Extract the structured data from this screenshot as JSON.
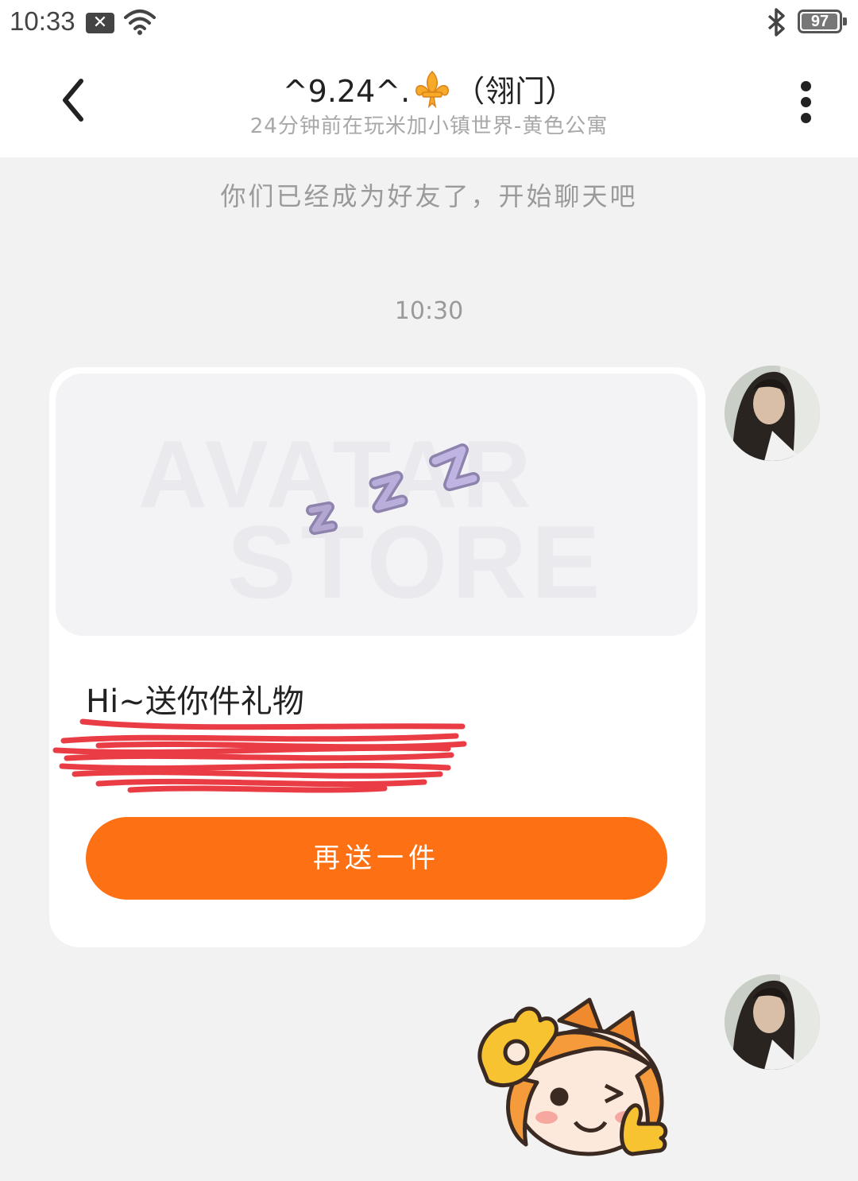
{
  "status_bar": {
    "time": "10:33",
    "notification_icon": "x-box-icon",
    "wifi_icon": "wifi-icon",
    "bluetooth_icon": "bluetooth-icon",
    "battery": "97",
    "battery_level": 0.97
  },
  "header": {
    "back_icon": "chevron-left-icon",
    "title_left": "^9.24^.",
    "title_icon": "fleur-de-lis-icon",
    "title_right": "（翎门）",
    "subtitle": "24分钟前在玩米加小镇世界-黄色公寓",
    "more_icon": "more-vertical-icon"
  },
  "chat": {
    "system_message": "你们已经成为好友了，开始聊天吧",
    "timestamp": "10:30",
    "gift_card": {
      "image_watermark": [
        "AVATAR",
        "STORE"
      ],
      "sleep_letters": [
        "z",
        "z",
        "z"
      ],
      "message": "Hi~送你件礼物",
      "resend_button": "再送一件"
    },
    "sticker_icon": "ok-gesture-sticker",
    "accent_color": "#fd7114"
  }
}
